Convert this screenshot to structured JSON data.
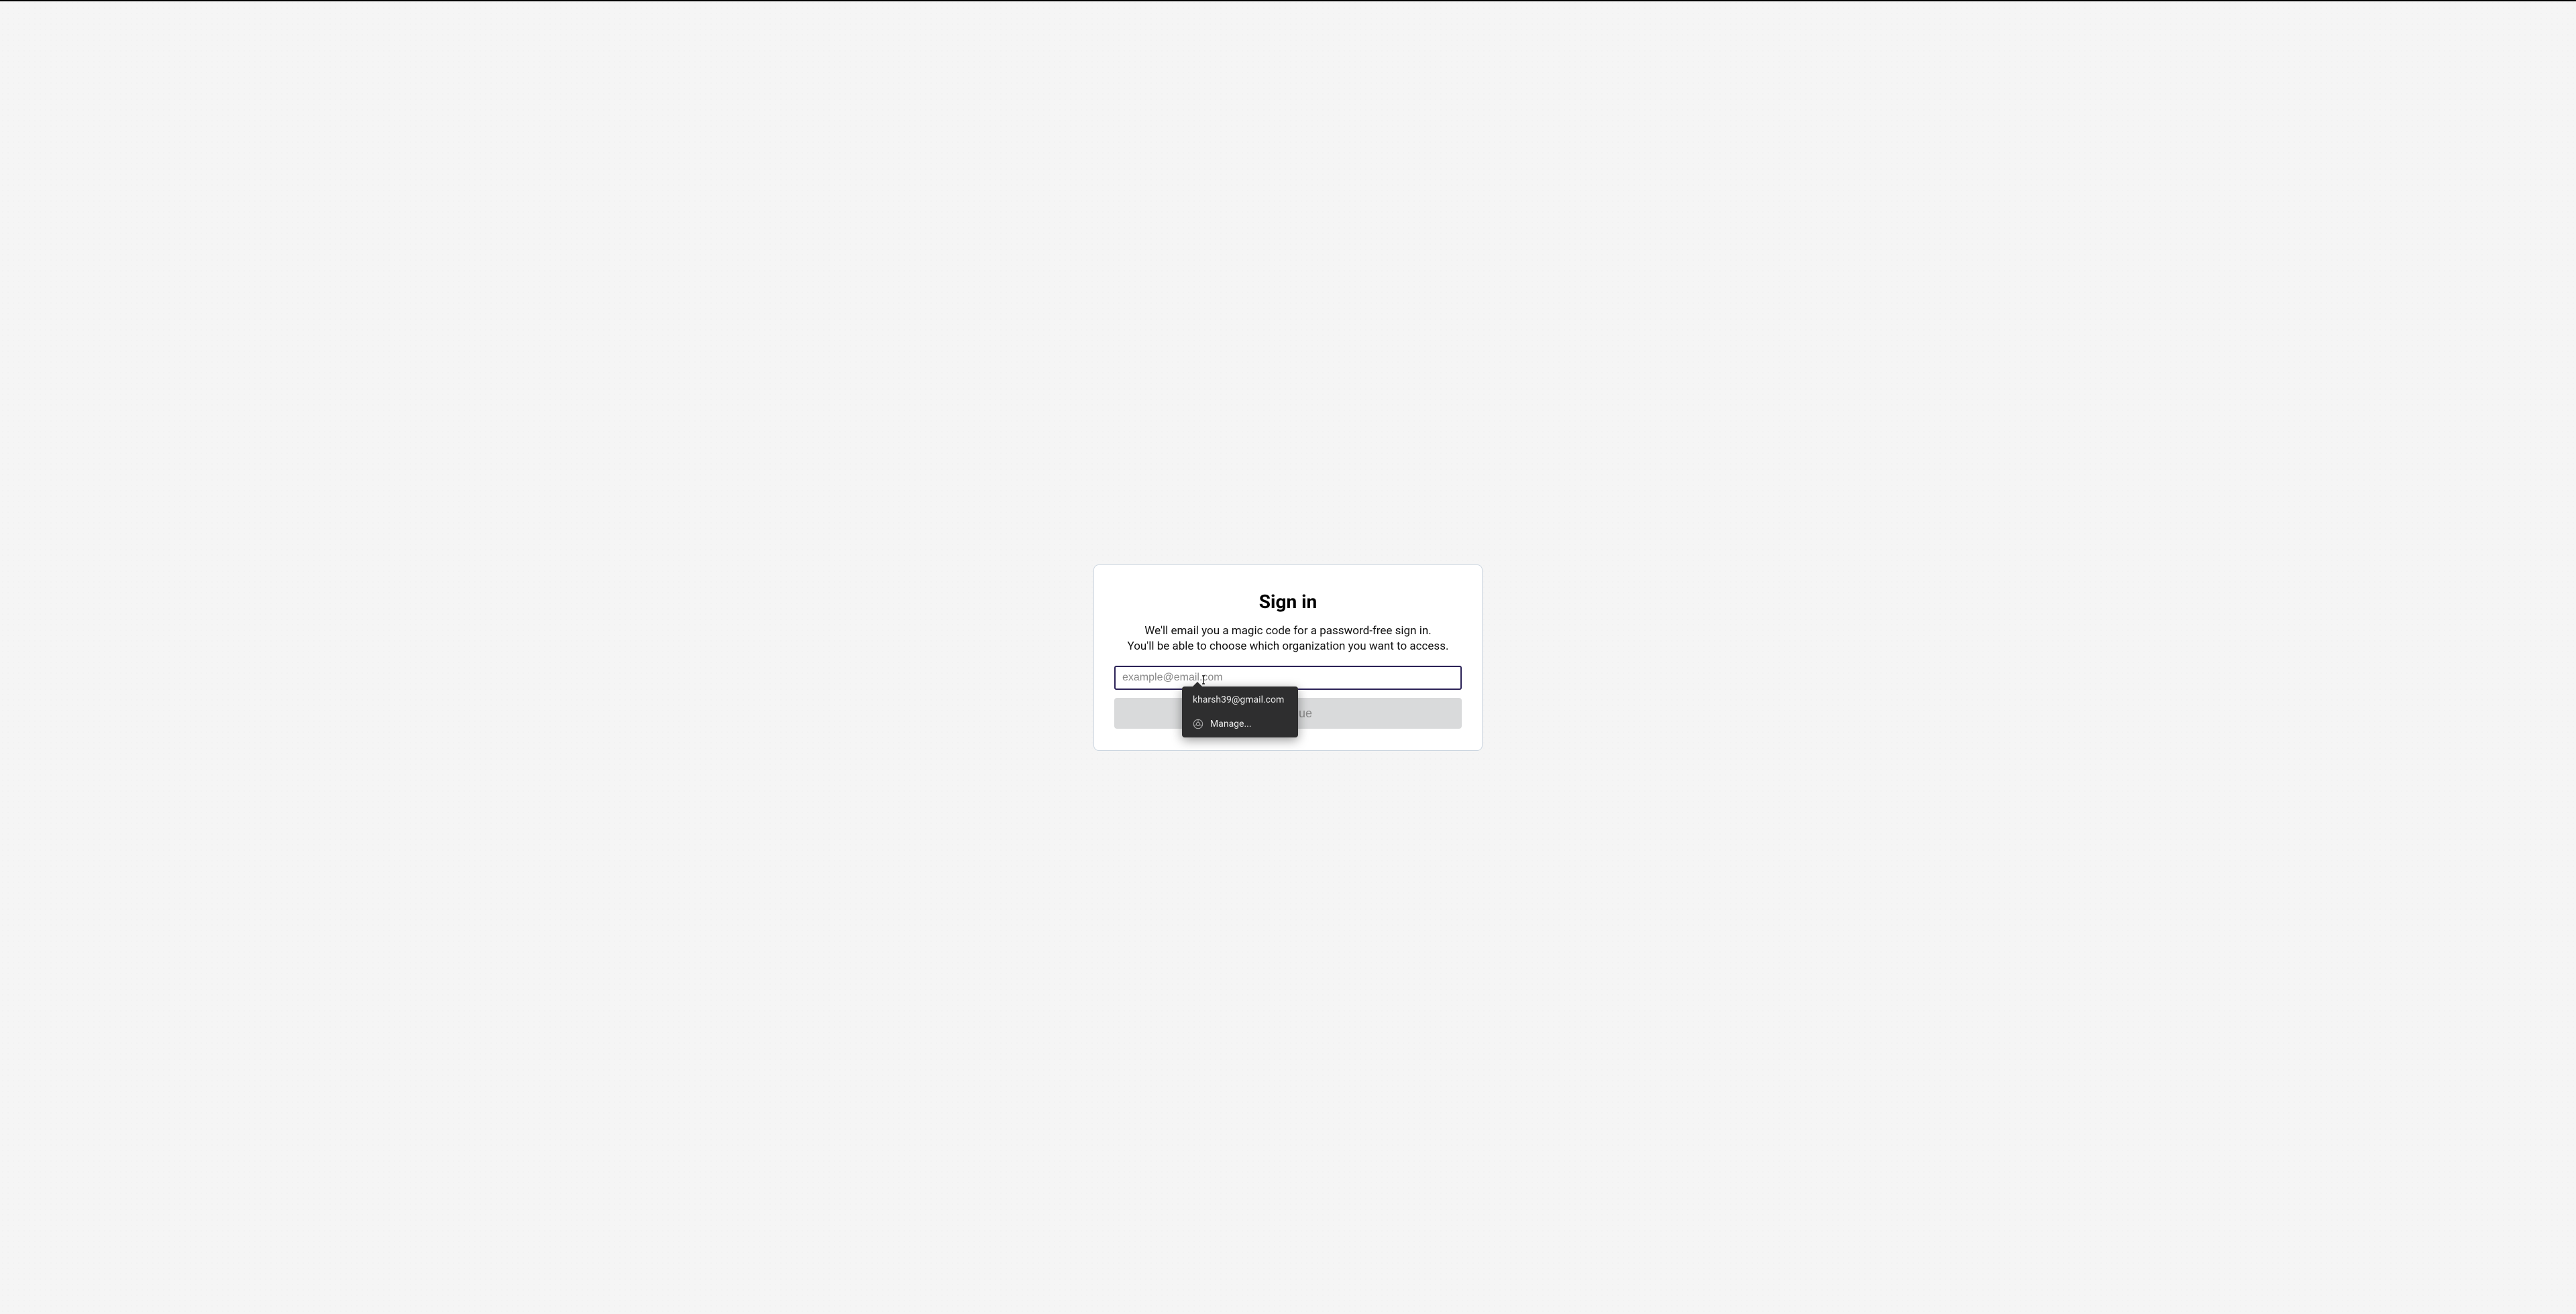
{
  "signin": {
    "title": "Sign in",
    "description_line1": "We'll email you a magic code for a password-free sign in.",
    "description_line2": "You'll be able to choose which organization you want to access.",
    "email_placeholder": "example@email.com",
    "email_value": "",
    "continue_label": "Continue"
  },
  "autofill": {
    "suggestion": "kharsh39@gmail.com",
    "manage_label": "Manage..."
  }
}
